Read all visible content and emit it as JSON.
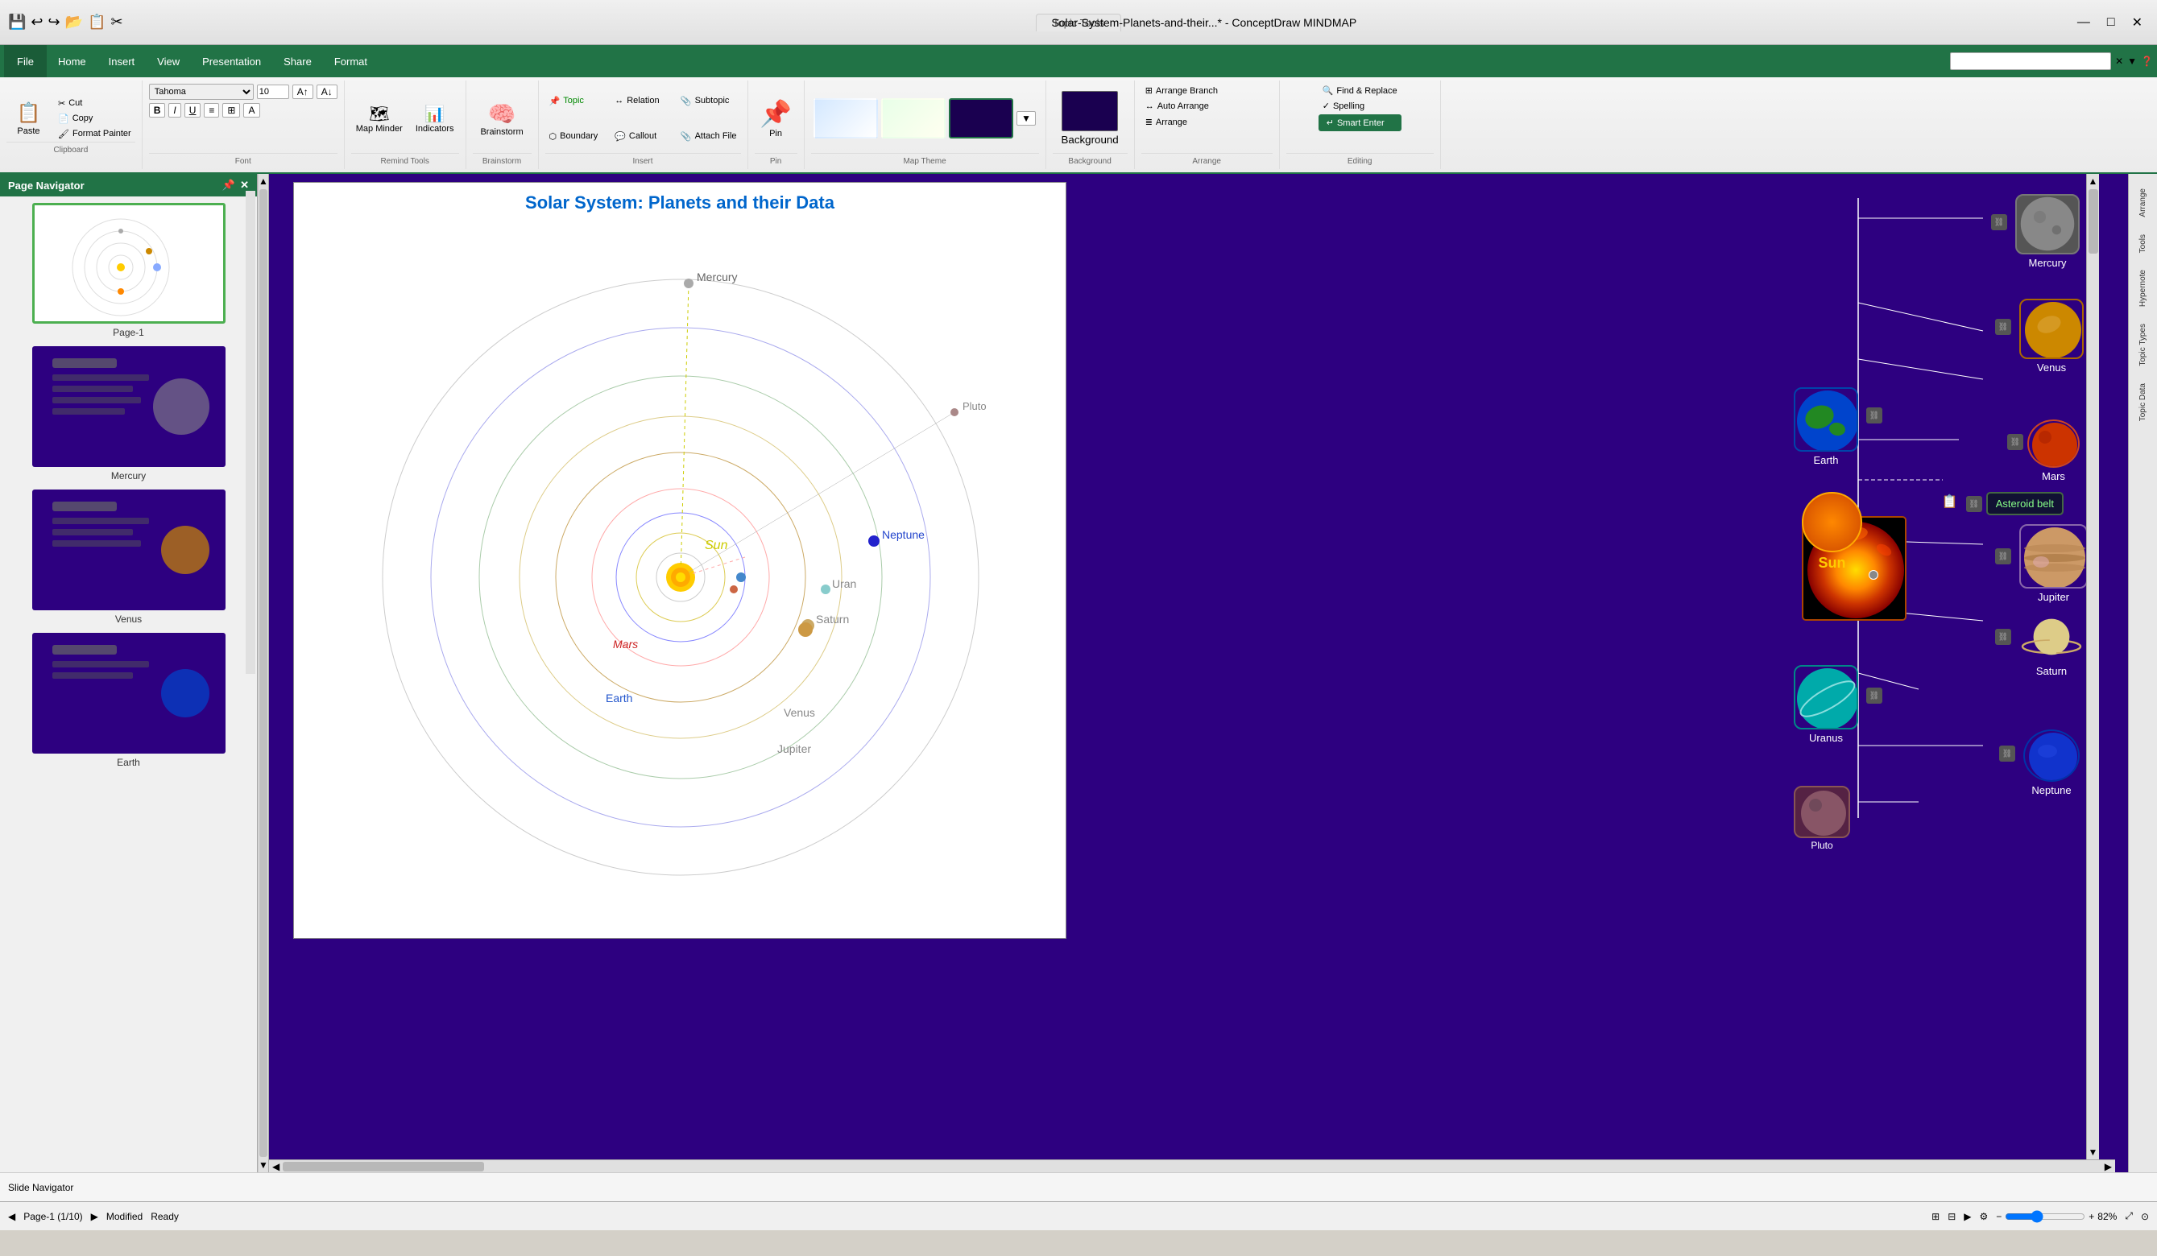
{
  "titlebar": {
    "app_icons": [
      "📁",
      "💾",
      "↩",
      "↪",
      "📋",
      "✂"
    ],
    "tab_tools": "Topic Tools",
    "title": "Solar-System-Planets-and-their...* - ConceptDraw MINDMAP",
    "window_controls": [
      "—",
      "□",
      "✕"
    ]
  },
  "menubar": {
    "file": "File",
    "items": [
      "Home",
      "Insert",
      "View",
      "Presentation",
      "Share",
      "Format"
    ],
    "search_placeholder": ""
  },
  "ribbon": {
    "clipboard": {
      "label": "Clipboard",
      "paste": "Paste",
      "cut": "Cut",
      "copy": "Copy",
      "format_painter": "Format Painter"
    },
    "font": {
      "label": "Font",
      "font_name": "Tahoma",
      "font_size": "10",
      "bold": "B",
      "italic": "I",
      "underline": "U"
    },
    "remind_tools": {
      "label": "Remind Tools",
      "map_minder": "Map Minder",
      "indicators": "Indicators"
    },
    "brainstorm": {
      "label": "Brainstorm"
    },
    "insert": {
      "label": "Insert",
      "topic": "Topic",
      "subtopic": "Subtopic",
      "callout": "Callout",
      "relation": "Relation",
      "boundary": "Boundary",
      "attach_file": "Attach File"
    },
    "pin": {
      "label": "Pin"
    },
    "map_theme": {
      "label": "Map Theme"
    },
    "background": {
      "label": "Background"
    },
    "arrange": {
      "label": "Arrange",
      "arrange_branch": "Arrange Branch",
      "auto_arrange": "Auto Arrange",
      "arrange": "Arrange"
    },
    "editing": {
      "label": "Editing",
      "find_replace": "Find & Replace",
      "spelling": "Spelling",
      "smart_enter": "Smart Enter"
    }
  },
  "page_navigator": {
    "title": "Page Navigator",
    "pages": [
      {
        "id": "page1",
        "label": "Page-1",
        "active": true
      },
      {
        "id": "mercury",
        "label": "Mercury",
        "active": false
      },
      {
        "id": "venus",
        "label": "Venus",
        "active": false
      },
      {
        "id": "earth",
        "label": "Earth",
        "active": false
      }
    ]
  },
  "canvas": {
    "title": "Solar System: Planets and their Data",
    "planets_diagram": {
      "sun_label": "Sun",
      "mercury_label": "Mercury",
      "venus_label": "Venus",
      "earth_label": "Earth",
      "mars_label": "Mars",
      "jupiter_label": "Jupiter",
      "saturn_label": "Saturn",
      "uran_label": "Uran",
      "neptune_label": "Neptune",
      "pluto_label": "Pluto"
    }
  },
  "mindmap": {
    "sun": "Sun",
    "mercury": "Mercury",
    "venus": "Venus",
    "earth": "Earth",
    "mars": "Mars",
    "asteroid_belt": "Asteroid belt",
    "jupiter": "Jupiter",
    "saturn": "Saturn",
    "uranus": "Uranus",
    "neptune": "Neptune",
    "pluto": "Pluto"
  },
  "right_tabs": [
    "Arrange",
    "Tools",
    "Hypernote",
    "Topic Types",
    "Topic Data"
  ],
  "statusbar": {
    "page_info": "Page-1 (1/10)",
    "status1": "Modified",
    "status2": "Ready",
    "zoom": "82%"
  },
  "slide_navigator": "Slide Navigator"
}
